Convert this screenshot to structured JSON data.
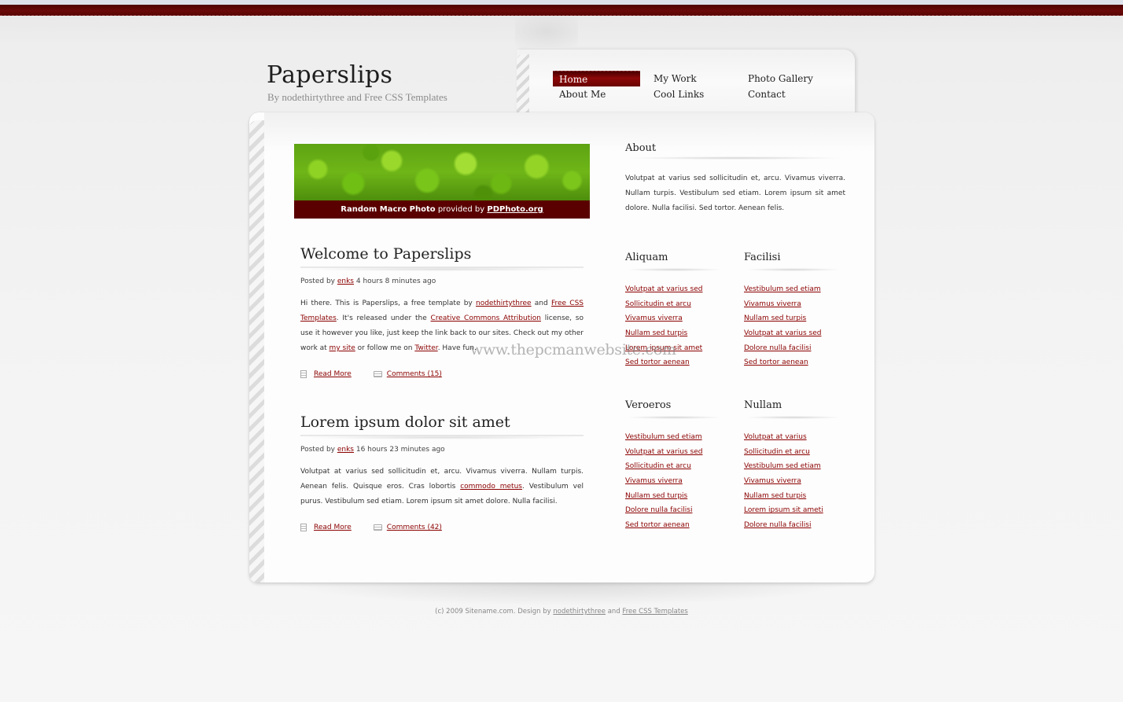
{
  "site": {
    "title": "Paperslips",
    "subtitle": "By nodethirtythree and Free CSS Templates"
  },
  "nav": {
    "items": [
      {
        "label": "Home",
        "active": true
      },
      {
        "label": "My Work",
        "active": false
      },
      {
        "label": "Photo Gallery",
        "active": false
      },
      {
        "label": "About Me",
        "active": false
      },
      {
        "label": "Cool Links",
        "active": false
      },
      {
        "label": "Contact",
        "active": false
      }
    ]
  },
  "photo": {
    "caption_prefix": "Random Macro Photo",
    "caption_mid": " provided by ",
    "caption_link": "PDPhoto.org"
  },
  "posts": [
    {
      "title": "Welcome to Paperslips",
      "meta_prefix": "Posted by ",
      "author": "enks",
      "time": " 4 hours 8 minutes ago",
      "body": {
        "t1": "Hi there. This is Paperslips, a free template by ",
        "l1": "nodethirtythree",
        "t2": " and ",
        "l2": "Free CSS Templates",
        "t3": ". It's released under the ",
        "l3": "Creative Commons Attribution",
        "t4": " license, so use it however you like, just keep the link back to our sites. Check out my other work at ",
        "l4": "my site",
        "t5": " or follow me on ",
        "l5": "Twitter",
        "t6": ". Have fun."
      },
      "read_more": "Read More",
      "comments": "Comments (15)"
    },
    {
      "title": "Lorem ipsum dolor sit amet",
      "meta_prefix": "Posted by ",
      "author": "enks",
      "time": " 16 hours 23 minutes ago",
      "body": {
        "t1": "Volutpat at varius sed sollicitudin et, arcu. Vivamus viverra. Nullam turpis. Aenean felis. Quisque eros. Cras lobortis ",
        "l1": "commodo metus",
        "t2": ". Vestibulum vel purus. Vestibulum sed etiam. Lorem ipsum sit amet dolore. Nulla facilisi."
      },
      "read_more": "Read More",
      "comments": "Comments (42)"
    }
  ],
  "sidebar": {
    "about": {
      "heading": "About",
      "text": "Volutpat at varius sed sollicitudin et, arcu. Vivamus viverra. Nullam turpis. Vestibulum sed etiam. Lorem ipsum sit amet dolore. Nulla facilisi. Sed tortor. Aenean felis."
    },
    "aliquam": {
      "heading": "Aliquam",
      "links": [
        "Volutpat at varius sed",
        "Sollicitudin et arcu",
        "Vivamus viverra",
        "Nullam sed turpis",
        "Lorem ipsum sit amet",
        "Sed tortor aenean"
      ]
    },
    "facilisi": {
      "heading": "Facilisi",
      "links": [
        "Vestibulum sed etiam",
        "Vivamus viverra",
        "Nullam sed turpis",
        "Volutpat at varius sed",
        "Dolore nulla facilisi",
        "Sed tortor aenean"
      ]
    },
    "veroeros": {
      "heading": "Veroeros",
      "links": [
        "Vestibulum sed etiam",
        "Volutpat at varius sed",
        "Sollicitudin et arcu",
        "Vivamus viverra",
        "Nullam sed turpis",
        "Dolore nulla facilisi",
        "Sed tortor aenean"
      ]
    },
    "nullam": {
      "heading": "Nullam",
      "links": [
        "Volutpat at varius",
        "Sollicitudin et arcu",
        "Vestibulum sed etiam",
        "Vivamus viverra",
        "Nullam sed turpis",
        "Lorem ipsum sit ameti",
        "Dolore nulla facilisi"
      ]
    }
  },
  "watermark": "www.thepcmanwebsite.com",
  "footer": {
    "prefix": "(c) 2009 Sitename.com. Design by ",
    "link1": "nodethirtythree",
    "mid": " and ",
    "link2": "Free CSS Templates"
  },
  "colors": {
    "accent": "#8b0000",
    "top_bar": "#5a0505",
    "caption_bg": "#5a0000"
  }
}
